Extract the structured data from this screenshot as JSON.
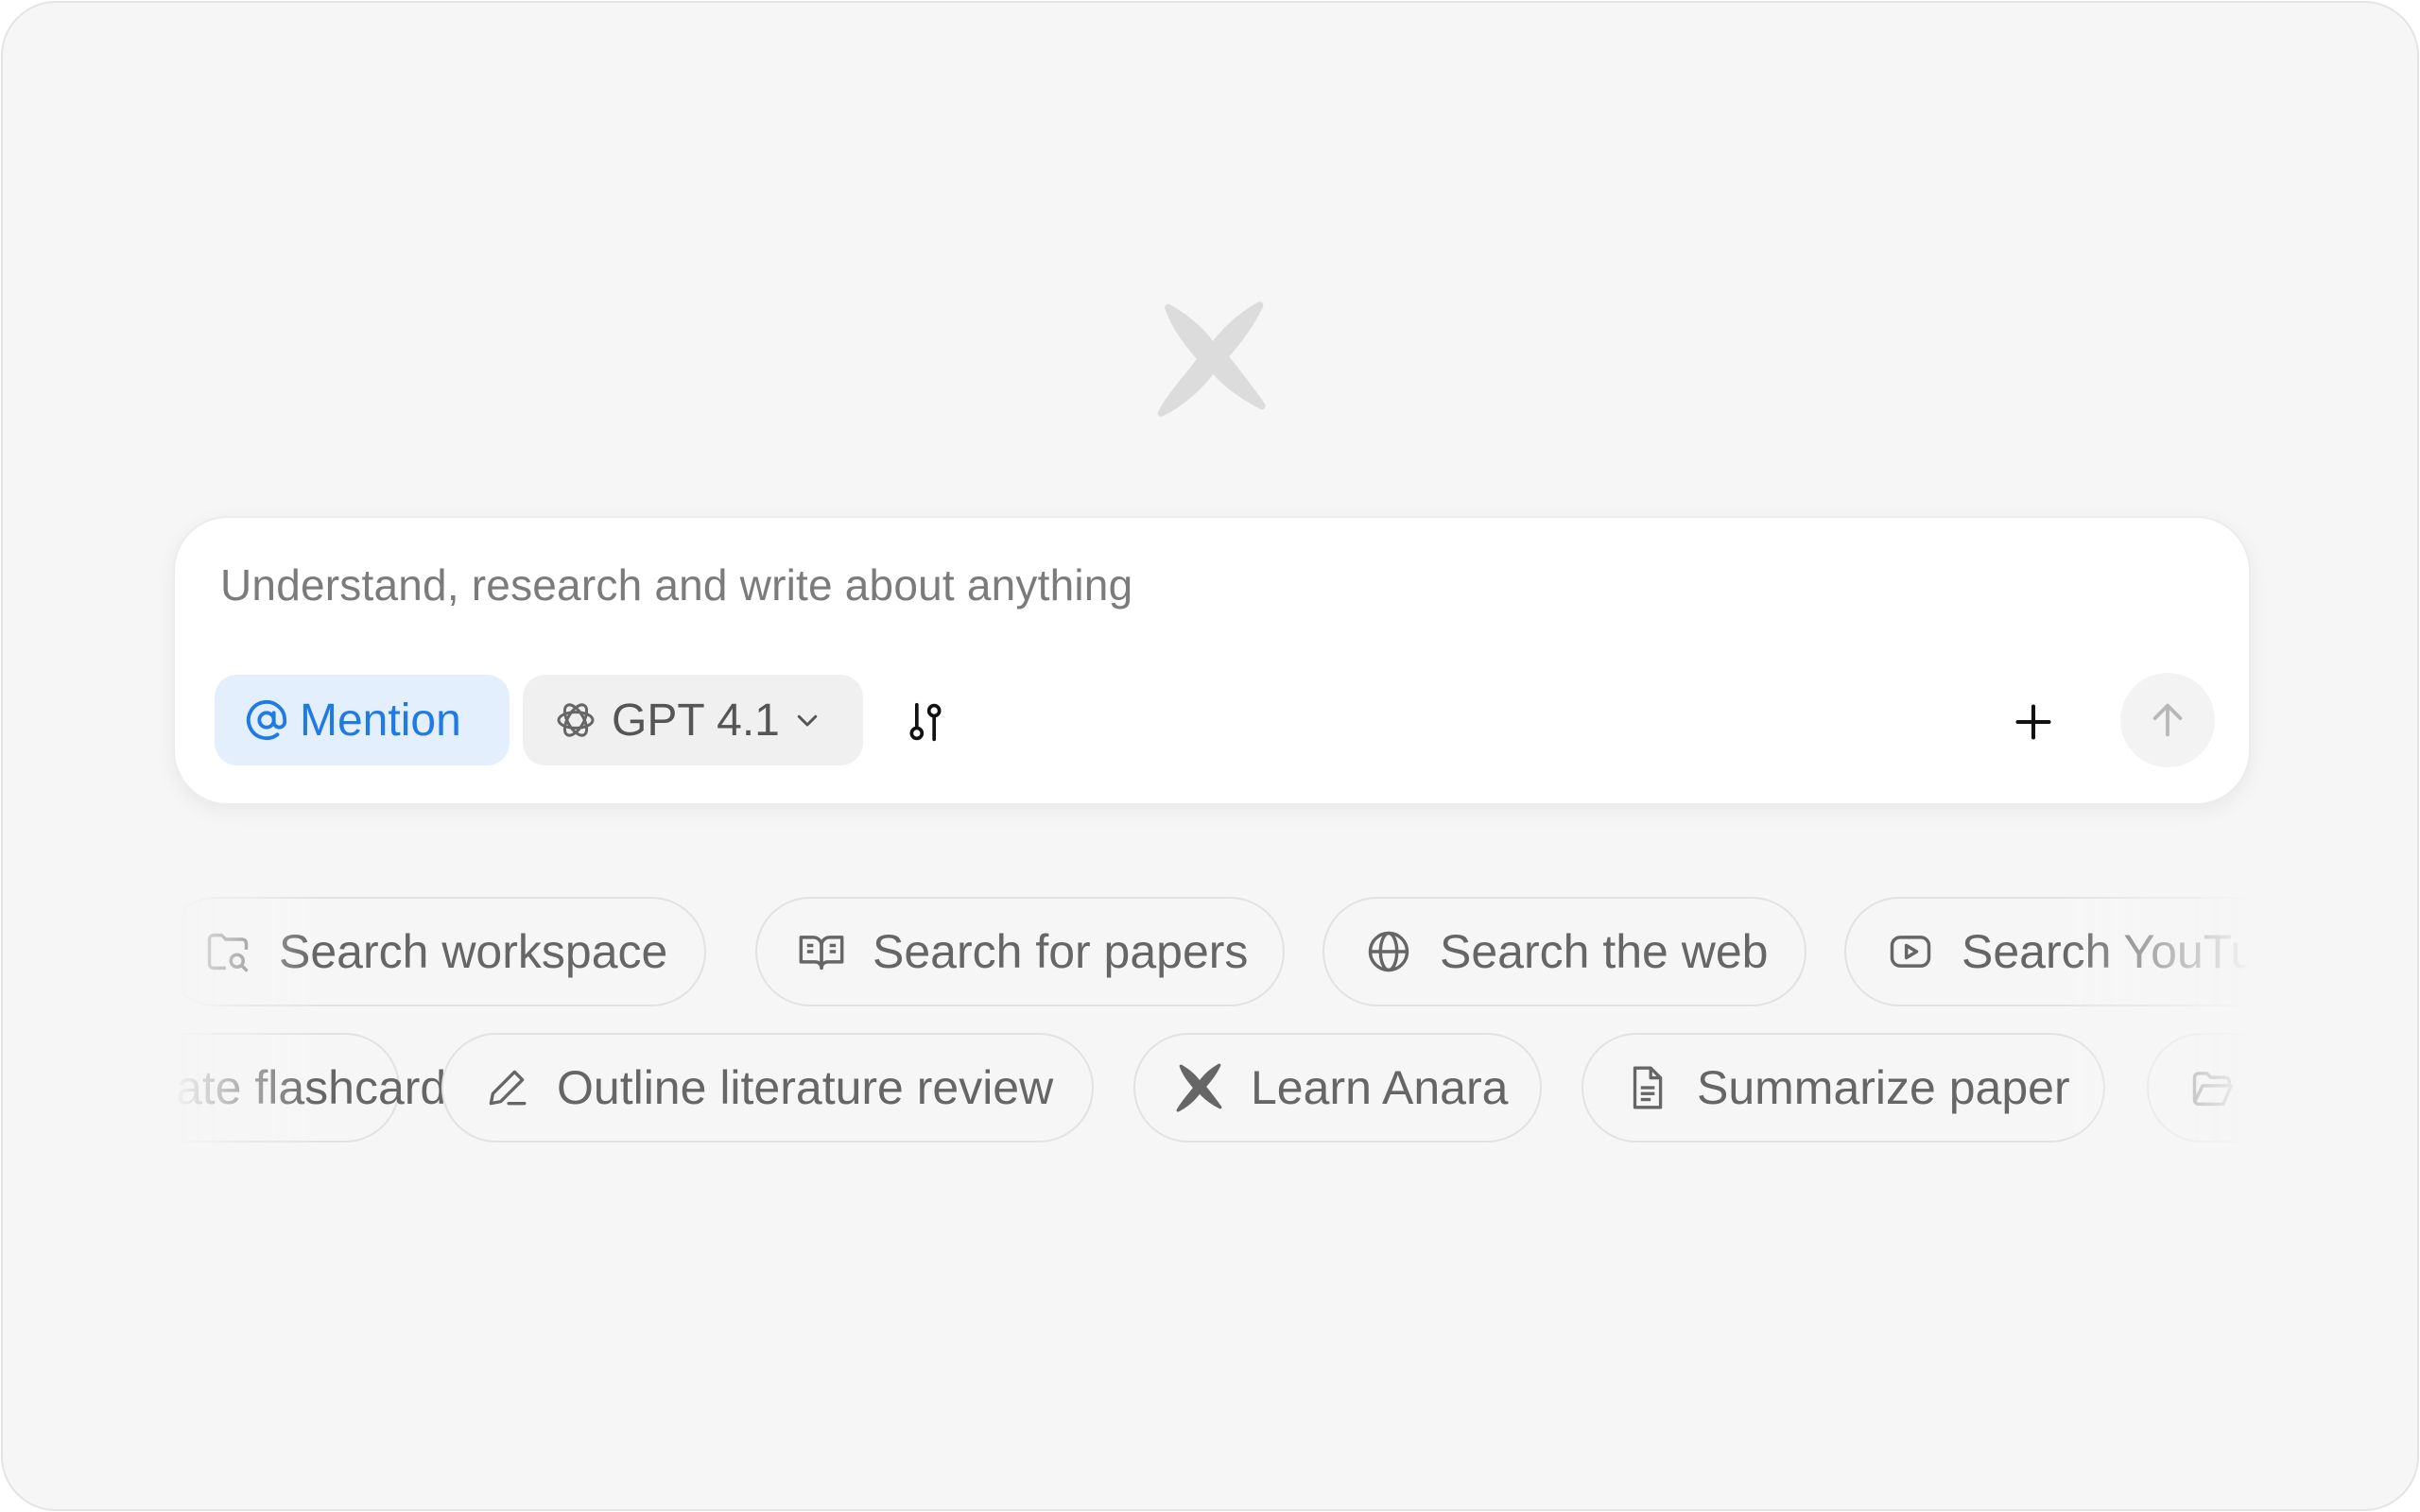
{
  "composer": {
    "placeholder": "Understand, research and write about anything",
    "mention_label": "Mention",
    "model_label": "GPT 4.1",
    "icons": {
      "mention": "at-icon",
      "model": "openai-logo-icon",
      "model_dropdown": "chevron-down-icon",
      "settings": "sliders-icon",
      "add": "plus-icon",
      "send": "arrow-up-icon"
    }
  },
  "suggestions": {
    "row1": [
      {
        "label": "Search workspace",
        "icon": "folder-search-icon"
      },
      {
        "label": "Search for papers",
        "icon": "book-open-icon"
      },
      {
        "label": "Search the web",
        "icon": "globe-icon"
      },
      {
        "label": "Search YouTube",
        "icon": "youtube-icon"
      }
    ],
    "row2": [
      {
        "label": "Generate flashcards",
        "icon": "cards-icon"
      },
      {
        "label": "Outline literature review",
        "icon": "pencil-icon"
      },
      {
        "label": "Learn Anara",
        "icon": "anara-logo-icon"
      },
      {
        "label": "Summarize paper",
        "icon": "document-icon"
      },
      {
        "label": "",
        "icon": "folder-open-icon"
      }
    ]
  },
  "colors": {
    "background": "#f6f6f6",
    "mention_bg": "#e3effd",
    "mention_text": "#1f7ae6",
    "logo": "#dcdcdc"
  }
}
